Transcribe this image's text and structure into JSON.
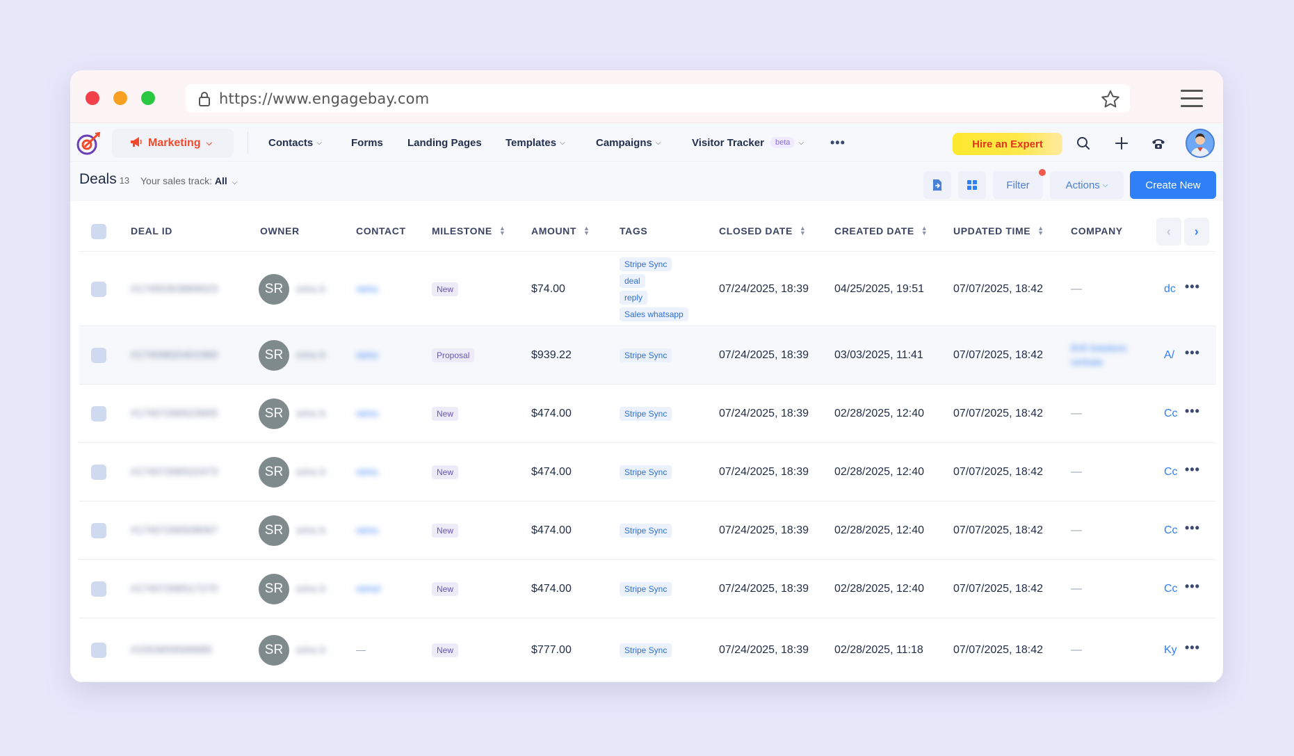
{
  "browser": {
    "url": "https://www.engagebay.com"
  },
  "nav": {
    "module_label": "Marketing",
    "items": [
      {
        "label": "Contacts",
        "dropdown": true
      },
      {
        "label": "Forms",
        "dropdown": false
      },
      {
        "label": "Landing Pages",
        "dropdown": false
      },
      {
        "label": "Templates",
        "dropdown": true
      },
      {
        "label": "Campaigns",
        "dropdown": true
      },
      {
        "label": "Visitor Tracker",
        "dropdown": true,
        "badge": "beta"
      }
    ],
    "more_label": "•••",
    "hire_label": "Hire an Expert",
    "icons": [
      "search-icon",
      "plus-icon",
      "phone-icon",
      "user-avatar"
    ]
  },
  "deals": {
    "title": "Deals",
    "count": "13",
    "track_label": "Your sales track:",
    "track_value": "All",
    "filter_label": "Filter",
    "actions_label": "Actions",
    "create_label": "Create New"
  },
  "table": {
    "headers": {
      "deal_id": "DEAL ID",
      "owner": "OWNER",
      "contact": "CONTACT",
      "milestone": "MILESTONE",
      "amount": "AMOUNT",
      "tags": "TAGS",
      "closed_date": "CLOSED DATE",
      "created_date": "CREATED DATE",
      "updated_time": "UPDATED TIME",
      "company": "COMPANY"
    },
    "rows": [
      {
        "deal_id": "#17455303869023",
        "owner_initials": "SR",
        "owner_name": "srinu b",
        "contact": "ramu",
        "milestone": "New",
        "amount": "$74.00",
        "tags": [
          "Stripe Sync",
          "deal",
          "reply",
          "Sales whatsapp"
        ],
        "closed": "07/24/2025, 18:39",
        "created": "04/25/2025, 19:51",
        "updated": "07/07/2025, 18:42",
        "company": "—",
        "col_next": "dc"
      },
      {
        "deal_id": "#17409820401960",
        "owner_initials": "SR",
        "owner_name": "srinu b",
        "contact": "ramu",
        "milestone": "Proposal",
        "amount": "$939.22",
        "tags": [
          "Stripe Sync"
        ],
        "closed": "07/24/2025, 18:39",
        "created": "03/03/2025, 11:41",
        "updated": "07/07/2025, 18:42",
        "company": "8V8 Solutions venkata",
        "col_next": "A/"
      },
      {
        "deal_id": "#17407266523905",
        "owner_initials": "SR",
        "owner_name": "srinu b",
        "contact": "ramu",
        "milestone": "New",
        "amount": "$474.00",
        "tags": [
          "Stripe Sync"
        ],
        "closed": "07/24/2025, 18:39",
        "created": "02/28/2025, 12:40",
        "updated": "07/07/2025, 18:42",
        "company": "—",
        "col_next": "Cc"
      },
      {
        "deal_id": "#17407266522473",
        "owner_initials": "SR",
        "owner_name": "srinu b",
        "contact": "ramu",
        "milestone": "New",
        "amount": "$474.00",
        "tags": [
          "Stripe Sync"
        ],
        "closed": "07/24/2025, 18:39",
        "created": "02/28/2025, 12:40",
        "updated": "07/07/2025, 18:42",
        "company": "—",
        "col_next": "Cc"
      },
      {
        "deal_id": "#17407266508067",
        "owner_initials": "SR",
        "owner_name": "srinu b",
        "contact": "ramu",
        "milestone": "New",
        "amount": "$474.00",
        "tags": [
          "Stripe Sync"
        ],
        "closed": "07/24/2025, 18:39",
        "created": "02/28/2025, 12:40",
        "updated": "07/07/2025, 18:42",
        "company": "—",
        "col_next": "Cc"
      },
      {
        "deal_id": "#17407266517270",
        "owner_initials": "SR",
        "owner_name": "srinu b",
        "contact": "ramul",
        "milestone": "New",
        "amount": "$474.00",
        "tags": [
          "Stripe Sync"
        ],
        "closed": "07/24/2025, 18:39",
        "created": "02/28/2025, 12:40",
        "updated": "07/07/2025, 18:42",
        "company": "—",
        "col_next": "Cc"
      },
      {
        "deal_id": "#1553659566685",
        "owner_initials": "SR",
        "owner_name": "srinu b",
        "contact": "—",
        "milestone": "New",
        "amount": "$777.00",
        "tags": [
          "Stripe Sync"
        ],
        "closed": "07/24/2025, 18:39",
        "created": "02/28/2025, 11:18",
        "updated": "07/07/2025, 18:42",
        "company": "—",
        "col_next": "Ky"
      }
    ]
  },
  "colors": {
    "accent": "#2f7ff7",
    "brand_orange": "#f04a2b",
    "hire_yellow": "#fee92f"
  }
}
